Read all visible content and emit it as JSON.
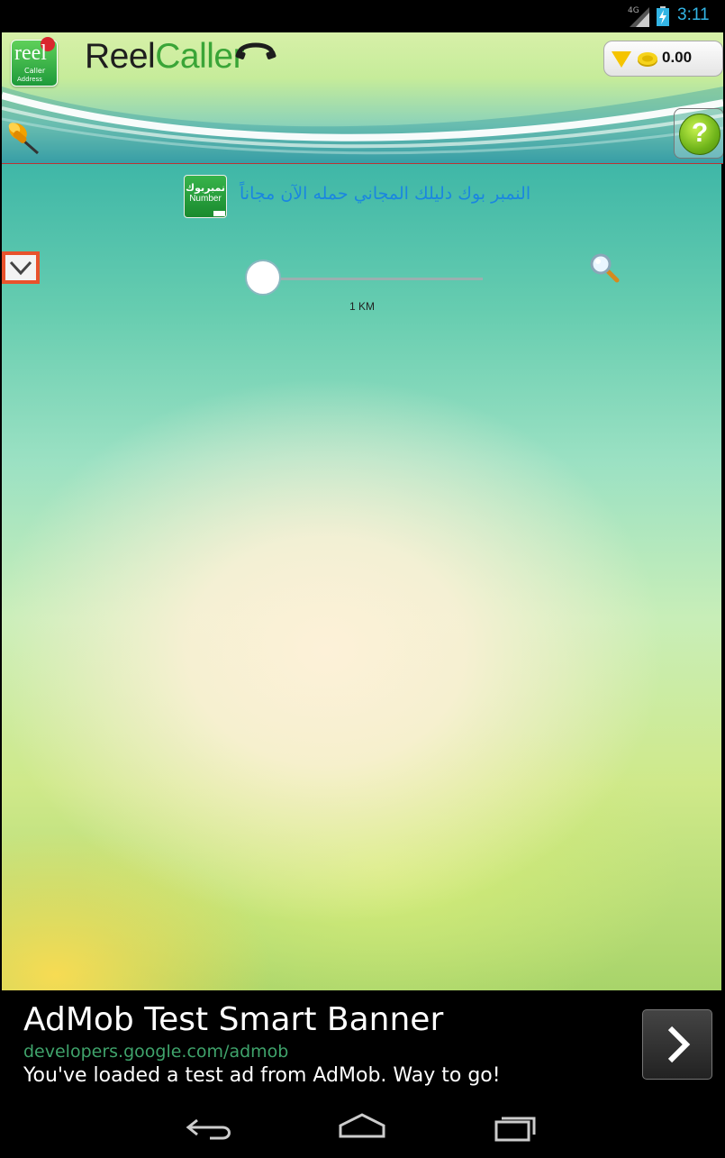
{
  "status_bar": {
    "network": "4G",
    "time": "3:11",
    "time_color": "#33b5e5"
  },
  "header": {
    "app_icon": {
      "word": "reel",
      "line1": "Caller",
      "line2": "Address"
    },
    "logo": {
      "part1": "Reel",
      "part2": "Caller"
    },
    "balance": "0.00"
  },
  "main": {
    "promo": {
      "icon_arabic": "نمبربوك",
      "icon_latin": "Number",
      "text": "النمبر بوك دليلك المجاني حمله الآن مجاناً",
      "text_color": "#1a86e0"
    },
    "distance": "1 KM"
  },
  "ad": {
    "title": "AdMob Test Smart Banner",
    "url": "developers.google.com/admob",
    "message": "You've loaded a test ad from AdMob. Way to go!"
  },
  "icons": {
    "pin": "pushpin-icon",
    "help": "help-icon",
    "collapse": "chevron-down-icon",
    "search": "magnifier-icon",
    "ad_go": "chevron-right-icon",
    "back": "back-icon",
    "home": "home-icon",
    "recents": "recents-icon"
  },
  "colors": {
    "accent_green": "#3aa537",
    "collapse_border": "#e8522c"
  }
}
